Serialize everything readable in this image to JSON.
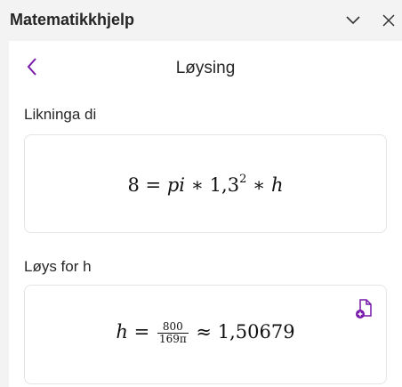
{
  "window": {
    "title": "Matematikkhjelp",
    "collapse_icon": "chevron-down-icon",
    "close_icon": "close-icon"
  },
  "panel": {
    "back_icon": "chevron-left-icon",
    "heading": "Løysing"
  },
  "equation_section": {
    "label": "Likninga di",
    "lhs": "8",
    "eq": "=",
    "pi": "pi",
    "op1": "∗",
    "base": "1,3",
    "exponent": "2",
    "op2": "∗",
    "var": "h"
  },
  "solution_section": {
    "label": "Løys for h",
    "var": "h",
    "eq": "=",
    "numerator": "800",
    "denominator": "169π",
    "approx": "≈",
    "value": "1,50679",
    "copy_icon": "copy-to-page-icon"
  },
  "colors": {
    "accent": "#7719aa",
    "background": "#f3f3f3",
    "panel": "#ffffff"
  }
}
